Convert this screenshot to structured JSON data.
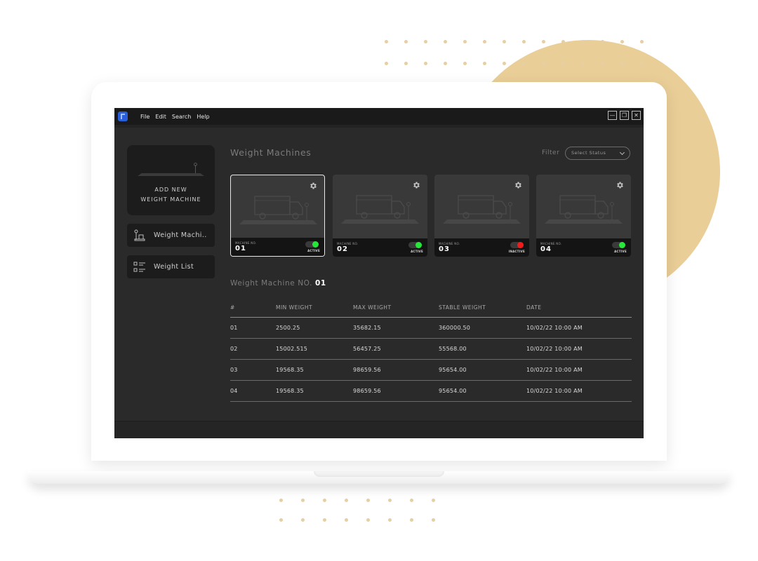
{
  "menu": [
    "File",
    "Edit",
    "Search",
    "Help"
  ],
  "window_controls": {
    "minimize": "—",
    "restore": "❐",
    "close": "✕"
  },
  "sidebar": {
    "add_label_line1": "ADD NEW",
    "add_label_line2": "WEIGHT MACHINE",
    "items": [
      {
        "label": "Weight Machi..",
        "icon": "scale-icon"
      },
      {
        "label": "Weight List",
        "icon": "list-icon"
      }
    ]
  },
  "main": {
    "title": "Weight Machines",
    "filter_label": "Filter",
    "filter_placeholder": "Select  Status"
  },
  "machines": [
    {
      "label": "MACHINE NO.",
      "number": "01",
      "status": "ACTIVE",
      "active": true,
      "selected": true
    },
    {
      "label": "MACHINE NO.",
      "number": "02",
      "status": "ACTIVE",
      "active": true,
      "selected": false
    },
    {
      "label": "MACHINE NO.",
      "number": "03",
      "status": "INACTIVE",
      "active": false,
      "selected": false
    },
    {
      "label": "MACHINE NO.",
      "number": "04",
      "status": "ACTIVE",
      "active": true,
      "selected": false
    }
  ],
  "status_colors": {
    "active": "#27e63a",
    "inactive": "#ee1c1c"
  },
  "detail": {
    "title_prefix": "Weight Machine NO.",
    "machine_number": "01",
    "columns": [
      "#",
      "MIN WEIGHT",
      "MAX WEIGHT",
      "STABLE WEIGHT",
      "DATE"
    ],
    "rows": [
      [
        "01",
        "2500.25",
        "35682.15",
        "360000.50",
        "10/02/22 10:00 AM"
      ],
      [
        "02",
        "15002.515",
        "56457.25",
        "55568.00",
        "10/02/22 10:00 AM"
      ],
      [
        "03",
        "19568.35",
        "98659.56",
        "95654.00",
        "10/02/22 10:00 AM"
      ],
      [
        "04",
        "19568.35",
        "98659.56",
        "95654.00",
        "10/02/22 10:00 AM"
      ]
    ]
  }
}
